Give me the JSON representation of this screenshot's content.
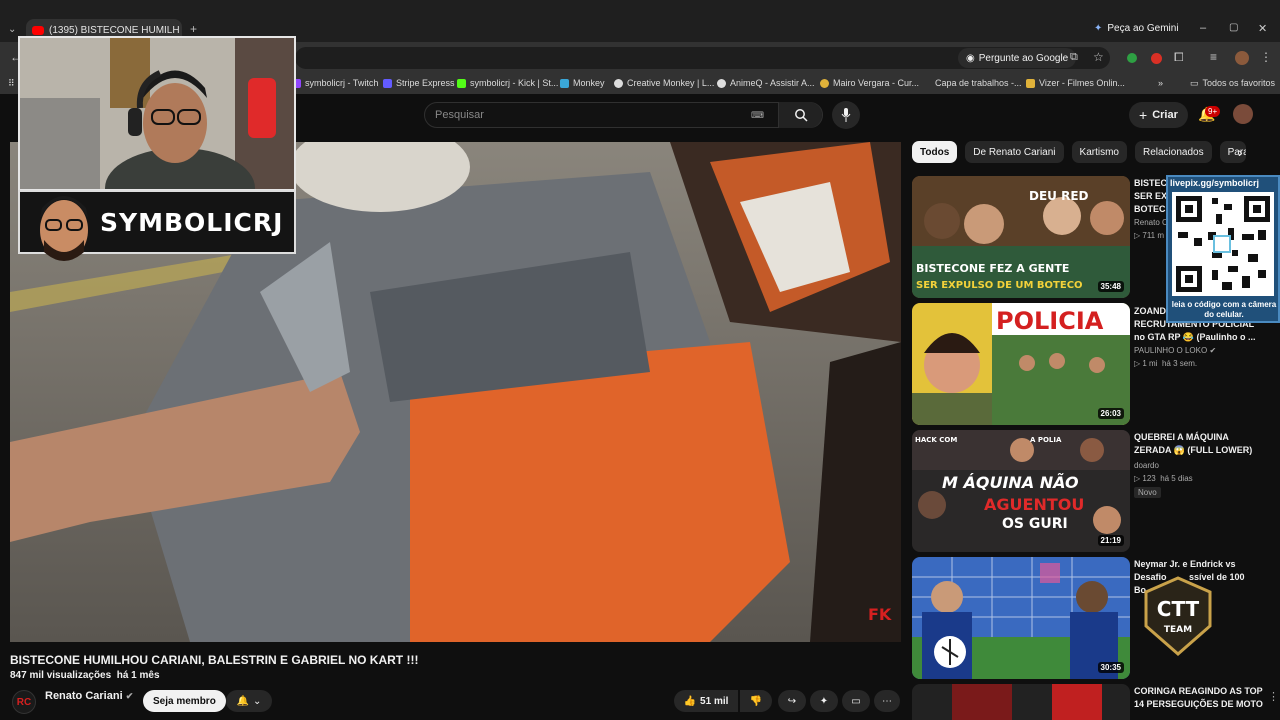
{
  "browser": {
    "tab_title": "(1395) BISTECONE HUMILH",
    "gemini_label": "Peça ao Gemini",
    "ask_google": "Pergunte ao Google",
    "bookmarks": [
      "symbolicrj - Twitch",
      "Stripe Express",
      "symbolicrj - Kick | St...",
      "Monkey",
      "Creative Monkey | L...",
      "AnimeQ - Assistir A...",
      "Mairo Vergara - Cur...",
      "Capa de trabalhos -...",
      "Vizer - Filmes Onlin..."
    ],
    "all_bookmarks": "Todos os favoritos"
  },
  "youtube": {
    "search_placeholder": "Pesquisar",
    "create_label": "Criar",
    "notif_badge": "9+"
  },
  "video": {
    "title": "BISTECONE HUMILHOU CARIANI, BALESTRIN E GABRIEL NO KART !!!",
    "views": "847 mil visualizações",
    "age": "há 1 mês",
    "channel": "Renato Cariani",
    "join_label": "Seja membro",
    "likes": "51 mil",
    "watermark": "FK"
  },
  "chips": [
    "Todos",
    "De Renato Cariani",
    "Kartismo",
    "Relacionados",
    "Para"
  ],
  "recommendations": [
    {
      "title": "BISTECONE FEZ A GENTE SER EXPULSO DE UM BOTECO",
      "title_visible": "BISTEC\nSER EX\nBOTEC",
      "channel": "Renato C",
      "views": "711 m",
      "duration": "35:48",
      "thumb_text": [
        "DEU RED",
        "BISTECONE FEZ A GENTE",
        "SER EXPULSO DE UM BOTECO"
      ],
      "colors": [
        "#6b4a2a",
        "#2a4a3a"
      ]
    },
    {
      "title": "ZOANDO RECRUTAMENTO POLICIAL no GTA RP 😂 (Paulinho o ...",
      "title_lines": [
        "ZOAND",
        "RECRUTAMENTO POLICIAL",
        "no GTA RP 😂 (Paulinho o ..."
      ],
      "channel": "PAULINHO O LOKO",
      "views": "1 mi",
      "age": "há 3 sem.",
      "duration": "26:03",
      "thumb_text": [
        "POLICIA"
      ],
      "colors": [
        "#e3c23a",
        "#3a5a2a"
      ]
    },
    {
      "title": "QUEBREI A MÁQUINA ZERADA 😱 (FULL LOWER)",
      "title_lines": [
        "QUEBREI A MÁQUINA",
        "ZERADA 😱 (FULL LOWER)"
      ],
      "channel": "doardo",
      "views": "123",
      "age": "há 5 dias",
      "badge": "Novo",
      "duration": "21:19",
      "thumb_text": [
        "HACK COM",
        "A POLIA",
        "M ÁQUINA NÃO",
        "AGUENTOU",
        "OS GURI"
      ],
      "colors": [
        "#2a2a2a",
        "#4a3a3a"
      ]
    },
    {
      "title": "Neymar Jr. e Endrick vs Desafio impossível de 100 Bo...",
      "title_lines": [
        "Neymar Jr. e Endrick vs",
        "Desafio         ssível de 100",
        "Bo"
      ],
      "channel": "",
      "views": "",
      "duration": "30:35",
      "thumb_text": [],
      "colors": [
        "#3a6ac0",
        "#4a8a3a"
      ]
    },
    {
      "title": "CORINGA REAGINDO AS TOP 14 PERSEGUIÇÕES DE MOTO",
      "title_lines": [
        "CORINGA REAGINDO AS TOP",
        "14 PERSEGUIÇÕES DE MOTO"
      ],
      "duration": "",
      "colors": [
        "#7a1a1a",
        "#222"
      ]
    }
  ],
  "overlay": {
    "streamer_name": "SYMBOLICRJ",
    "qr_header": "livepix.gg/symbolicrj",
    "qr_footer": "leia o código com a câmera do celular.",
    "team_logo": "CTT TEAM"
  }
}
